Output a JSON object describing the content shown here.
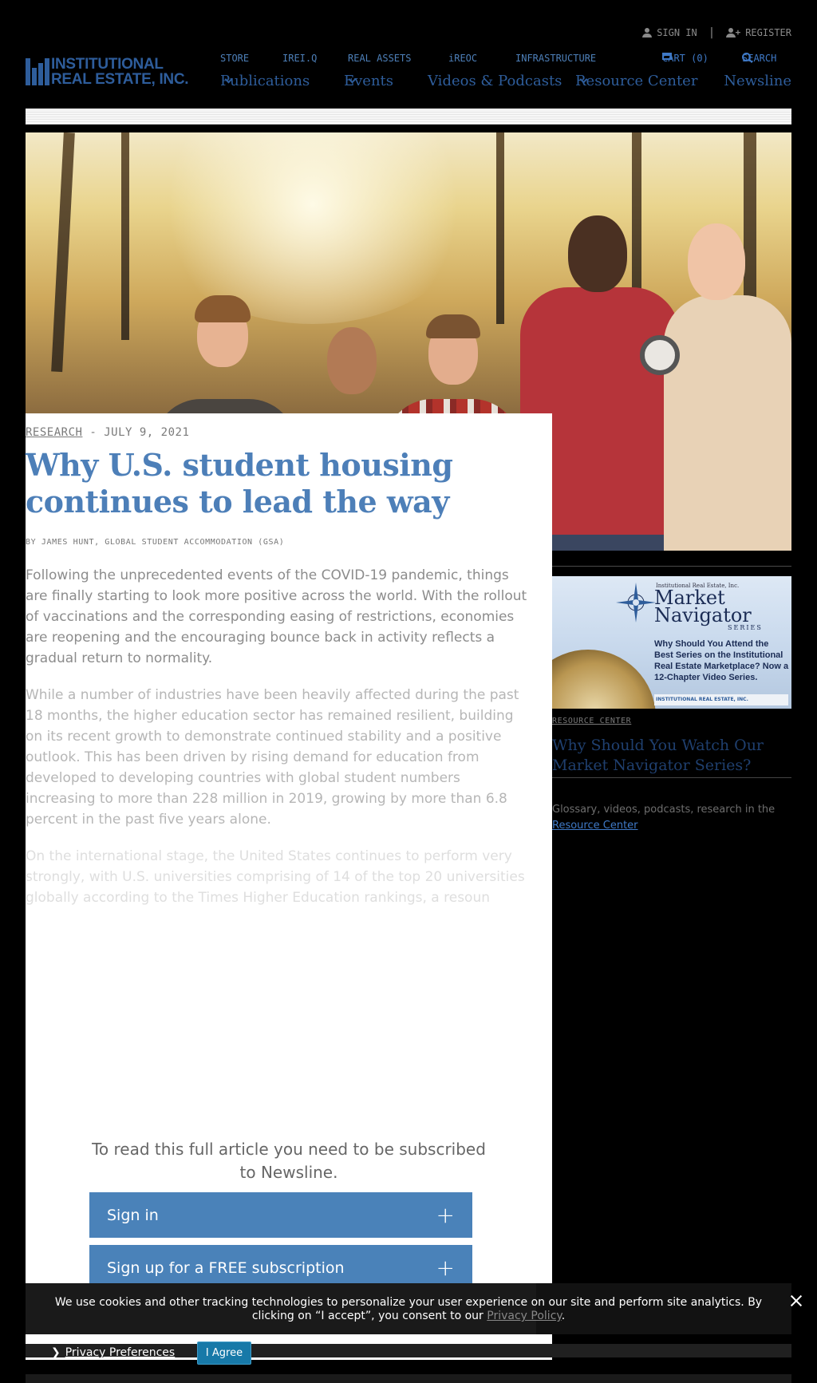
{
  "header": {
    "sign_in": "SIGN IN",
    "register": "REGISTER",
    "logo_line1": "INSTITUTIONAL",
    "logo_line2": "REAL ESTATE, INC.",
    "subnav": {
      "store": "STORE",
      "ireiq": "IREI.Q",
      "real_assets": "REAL ASSETS",
      "ireoc": "iREOC",
      "infrastructure": "INFRASTRUCTURE",
      "cart": "CART (0)",
      "search": "SEARCH"
    },
    "mainnav": {
      "publications": "Publications",
      "events": "Events",
      "videos": "Videos & Podcasts",
      "resource_center": "Resource Center",
      "newsline": "Newsline"
    }
  },
  "article": {
    "category": "RESEARCH",
    "date": " - JULY 9, 2021",
    "headline": "Why U.S. student housing continues to lead the way",
    "byline": "BY JAMES HUNT, GLOBAL STUDENT ACCOMMODATION (GSA)",
    "paragraphs": [
      "Following the unprecedented events of the COVID-19 pandemic, things are finally starting to look more positive across the world. With the rollout of vaccinations and the corresponding easing of restrictions, economies are reopening and the encouraging bounce back in activity reflects a gradual return to normality.",
      "While a number of industries have been heavily affected during the past 18 months, the higher education sector has remained resilient, building on its recent growth to demonstrate continued stability and a positive outlook. This has been driven by rising demand for education from developed to developing countries with global student numbers increasing to more than 228 million in 2019, growing by more than 6.8 percent in the past five years alone.",
      "On the international stage, the United States continues to perform very strongly, with U.S. universities comprising of 14 of the top 20 universities globally according to the Times Higher Education rankings, a resoun"
    ],
    "paywall_message": "To read this full article you need to be subscribed to Newsline.",
    "sign_in_button": "Sign in",
    "signup_button": "Sign up for a FREE subscription"
  },
  "sidebar": {
    "ad": {
      "publisher": "Institutional Real Estate, Inc.",
      "title": "Market Navigator",
      "series": "SERIES",
      "question": "Why Should You Attend the Best Series on the Institutional Real Estate Marketplace? Now a 12-Chapter Video Series.",
      "footer": "INSTITUTIONAL REAL ESTATE, INC."
    },
    "category": "RESOURCE CENTER",
    "title": "Why Should You Watch Our Market Navigator Series?",
    "blurb": "Glossary, videos, podcasts, research in the",
    "blurb_link": "Resource Center"
  },
  "cookie": {
    "text": "We use cookies and other tracking technologies to personalize your user experience on our site and perform site analytics. By clicking on “I accept”, you consent to our",
    "link": "Privacy Policy",
    "period": ".",
    "privacy_prefs": "Privacy Preferences",
    "agree": "I Agree"
  },
  "colors": {
    "brand_blue": "#2e5d9b",
    "link_blue": "#3f79c6",
    "button_blue": "#4a82b9",
    "agree_blue": "#1779a8"
  }
}
